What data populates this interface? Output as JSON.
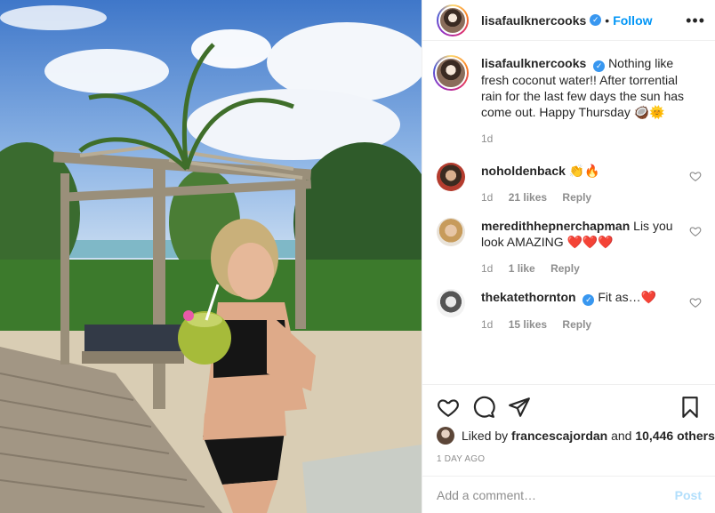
{
  "colors": {
    "link": "#0095f6",
    "verified": "#3897f0",
    "heart_red": "#ed4956",
    "muted": "#8e8e8e",
    "post_disabled": "#b2dffc"
  },
  "header": {
    "username": "lisafaulknercooks",
    "separator": "•",
    "follow_label": "Follow",
    "more_icon": "ellipsis-icon"
  },
  "caption": {
    "username": "lisafaulknercooks",
    "text": "Nothing like fresh coconut water!! After torrential rain for the last few days the sun has come out. Happy Thursday 🥥🌞",
    "age": "1d"
  },
  "comments": [
    {
      "username": "noholdenback",
      "text": "👏🔥",
      "age": "1d",
      "likes": "21 likes",
      "reply": "Reply"
    },
    {
      "username": "meredithhepnerchapman",
      "text": "Lis you look AMAZING ❤️❤️❤️",
      "age": "1d",
      "likes": "1 like",
      "reply": "Reply"
    },
    {
      "username": "thekatethornton",
      "text": "Fit as…❤️",
      "age": "1d",
      "likes": "15 likes",
      "reply": "Reply"
    }
  ],
  "actions": {
    "like_icon": "heart-icon",
    "comment_icon": "comment-icon",
    "share_icon": "share-icon",
    "save_icon": "bookmark-icon"
  },
  "likes": {
    "prefix": "Liked by",
    "user": "francescajordan",
    "and": "and",
    "count": "10,446 others"
  },
  "timestamp": "1 DAY AGO",
  "add_comment": {
    "placeholder": "Add a comment…",
    "post_label": "Post"
  }
}
